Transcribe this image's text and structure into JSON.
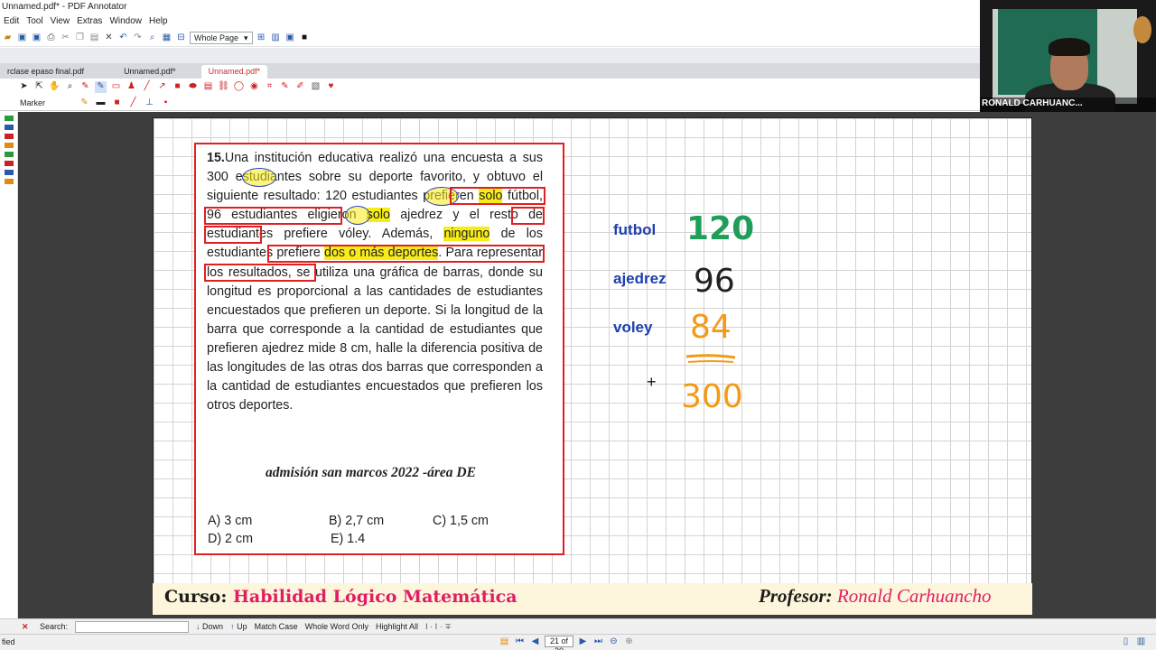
{
  "window": {
    "title": "Unnamed.pdf* - PDF Annotator",
    "menu": [
      "Edit",
      "Tool",
      "View",
      "Extras",
      "Window",
      "Help"
    ],
    "zoom_select": "Whole Page"
  },
  "tabs": [
    {
      "label": "rclase epaso final.pdf",
      "active": false
    },
    {
      "label": "Unnamed.pdf*",
      "active": false
    },
    {
      "label": "Unnamed.pdf*",
      "active": true
    }
  ],
  "tool_label": "Marker",
  "camera": {
    "name": "RONALD CARHUANC..."
  },
  "problem": {
    "number": "15.",
    "source": "admisión san marcos 2022 -área DE",
    "options": {
      "a": "A) 3 cm",
      "b": "B) 2,7 cm",
      "c": "C) 1,5 cm",
      "d": "D) 2 cm",
      "e": "E) 1.4"
    }
  },
  "annotations": {
    "labels": [
      "futbol",
      "ajedrez",
      "voley"
    ],
    "values": [
      "120",
      "96",
      "84"
    ],
    "total": "300",
    "colors": {
      "futbol": "#1f9e5a",
      "ajedrez": "#222222",
      "voley": "#f39a17",
      "total": "#f39a17",
      "label": "#1e3fae"
    }
  },
  "footer": {
    "course_label": "Curso:",
    "course": "Habilidad Lógico Matemática",
    "teacher_label": "Profesor:",
    "teacher": "Ronald Carhuancho"
  },
  "search": {
    "label": "Search:",
    "down": "Down",
    "up": "Up",
    "match_case": "Match Case",
    "whole_word": "Whole Word Only",
    "highlight_all": "Highlight All"
  },
  "status": {
    "left": "fied",
    "page": "21 of 30"
  }
}
